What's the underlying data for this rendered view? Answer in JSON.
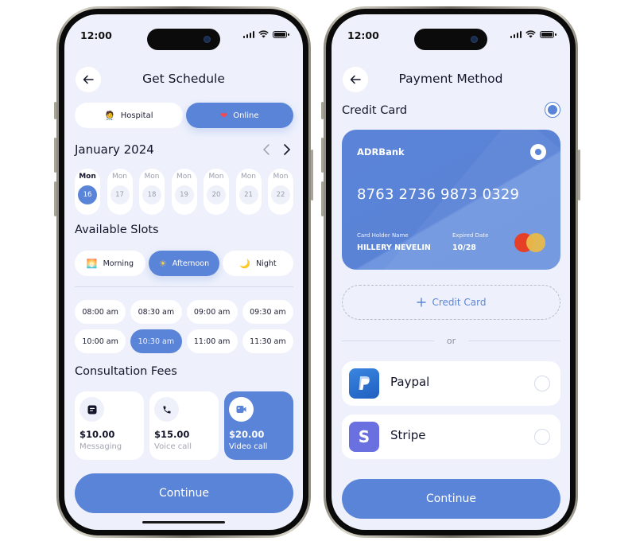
{
  "status_bar": {
    "time": "12:00"
  },
  "schedule_screen": {
    "title": "Get Schedule",
    "consult_type": {
      "options": [
        {
          "label": "Hospital",
          "icon": "doctor-icon",
          "selected": false
        },
        {
          "label": "Online",
          "icon": "heart-pulse-icon",
          "selected": true
        }
      ]
    },
    "calendar": {
      "month_label": "January 2024",
      "days": [
        {
          "name": "Mon",
          "date": "16",
          "selected": true
        },
        {
          "name": "Mon",
          "date": "17",
          "selected": false
        },
        {
          "name": "Mon",
          "date": "18",
          "selected": false
        },
        {
          "name": "Mon",
          "date": "19",
          "selected": false
        },
        {
          "name": "Mon",
          "date": "20",
          "selected": false
        },
        {
          "name": "Mon",
          "date": "21",
          "selected": false
        },
        {
          "name": "Mon",
          "date": "22",
          "selected": false
        }
      ]
    },
    "available_slots": {
      "heading": "Available Slots",
      "periods": [
        {
          "label": "Morning",
          "icon": "sunrise-icon",
          "selected": false
        },
        {
          "label": "Afternoon",
          "icon": "sun-icon",
          "selected": true
        },
        {
          "label": "Night",
          "icon": "moon-icon",
          "selected": false
        }
      ],
      "times": [
        {
          "label": "08:00 am",
          "selected": false
        },
        {
          "label": "08:30 am",
          "selected": false
        },
        {
          "label": "09:00 am",
          "selected": false
        },
        {
          "label": "09:30 am",
          "selected": false
        },
        {
          "label": "10:00 am",
          "selected": false
        },
        {
          "label": "10:30 am",
          "selected": true
        },
        {
          "label": "11:00 am",
          "selected": false
        },
        {
          "label": "11:30 am",
          "selected": false
        }
      ]
    },
    "fees": {
      "heading": "Consultation Fees",
      "options": [
        {
          "price": "$10.00",
          "label": "Messaging",
          "icon": "message-icon",
          "selected": false
        },
        {
          "price": "$15.00",
          "label": "Voice call",
          "icon": "phone-icon",
          "selected": false
        },
        {
          "price": "$20.00",
          "label": "Video call",
          "icon": "video-icon",
          "selected": true
        }
      ]
    },
    "continue_label": "Continue"
  },
  "payment_screen": {
    "title": "Payment Method",
    "credit_card_heading": "Credit Card",
    "card": {
      "bank_name": "ADRBank",
      "number": "8763 2736 9873 0329",
      "holder_label": "Card Holder Name",
      "holder_name": "HILLERY NEVELIN",
      "expiry_label": "Expired Date",
      "expiry": "10/28",
      "network": "mastercard"
    },
    "add_card_label": "Credit Card",
    "or_label": "or",
    "methods": [
      {
        "name": "Paypal",
        "logo_letter": "P",
        "color": "#2f74d0",
        "selected": false
      },
      {
        "name": "Stripe",
        "logo_letter": "S",
        "color": "#6b70e0",
        "selected": false
      }
    ],
    "continue_label": "Continue"
  },
  "colors": {
    "accent": "#5a84d8",
    "background": "#eef1fc",
    "text": "#14152a"
  }
}
